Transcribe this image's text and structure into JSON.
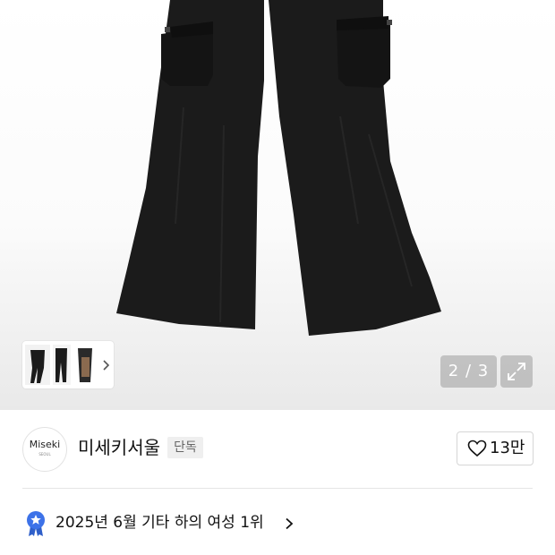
{
  "gallery": {
    "counter": "2 / 3",
    "current_index": 2,
    "total": 3
  },
  "brand": {
    "logo_text": "Miseki",
    "logo_subtext": "SEOUL",
    "name": "미세키서울",
    "badge": "단독"
  },
  "like": {
    "count": "13만",
    "icon": "heart-outline-icon"
  },
  "ranking": {
    "text": "2025년 6월 기타 하의 여성 1위",
    "icon": "ranking-medal-icon",
    "accent": "#3d72e8"
  },
  "colors": {
    "pants": "#1c1c1c",
    "hero_bottom": "#e9e9e9",
    "counter_bg": "rgba(140,140,140,0.45)"
  }
}
